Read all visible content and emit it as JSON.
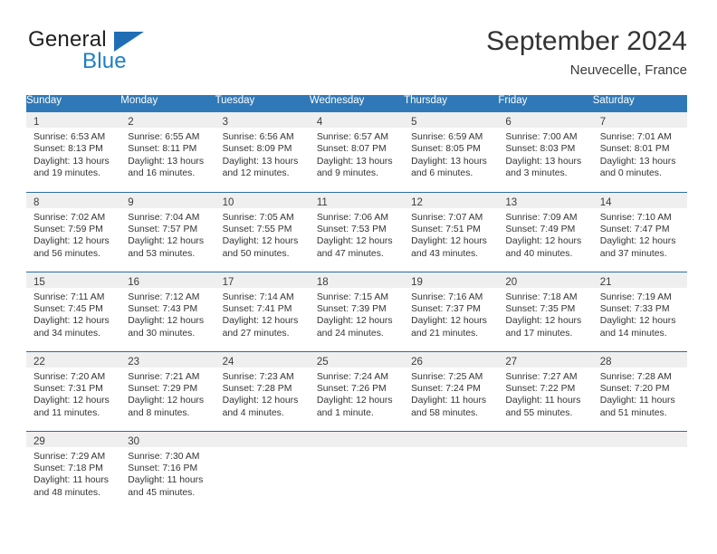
{
  "brand": {
    "word_general": "General",
    "word_blue": "Blue",
    "triangle_color": "#1f6eb5",
    "blue_text_color": "#1e7fc4"
  },
  "header": {
    "title": "September 2024",
    "location": "Neuvecelle, France"
  },
  "theme": {
    "header_row_bg": "#3079b8",
    "week_separator": "#2d6ca8",
    "daynum_band_bg": "#efefef"
  },
  "weekdays": [
    "Sunday",
    "Monday",
    "Tuesday",
    "Wednesday",
    "Thursday",
    "Friday",
    "Saturday"
  ],
  "weeks": [
    [
      {
        "day": "1",
        "sunrise": "Sunrise: 6:53 AM",
        "sunset": "Sunset: 8:13 PM",
        "daylight_1": "Daylight: 13 hours",
        "daylight_2": "and 19 minutes."
      },
      {
        "day": "2",
        "sunrise": "Sunrise: 6:55 AM",
        "sunset": "Sunset: 8:11 PM",
        "daylight_1": "Daylight: 13 hours",
        "daylight_2": "and 16 minutes."
      },
      {
        "day": "3",
        "sunrise": "Sunrise: 6:56 AM",
        "sunset": "Sunset: 8:09 PM",
        "daylight_1": "Daylight: 13 hours",
        "daylight_2": "and 12 minutes."
      },
      {
        "day": "4",
        "sunrise": "Sunrise: 6:57 AM",
        "sunset": "Sunset: 8:07 PM",
        "daylight_1": "Daylight: 13 hours",
        "daylight_2": "and 9 minutes."
      },
      {
        "day": "5",
        "sunrise": "Sunrise: 6:59 AM",
        "sunset": "Sunset: 8:05 PM",
        "daylight_1": "Daylight: 13 hours",
        "daylight_2": "and 6 minutes."
      },
      {
        "day": "6",
        "sunrise": "Sunrise: 7:00 AM",
        "sunset": "Sunset: 8:03 PM",
        "daylight_1": "Daylight: 13 hours",
        "daylight_2": "and 3 minutes."
      },
      {
        "day": "7",
        "sunrise": "Sunrise: 7:01 AM",
        "sunset": "Sunset: 8:01 PM",
        "daylight_1": "Daylight: 13 hours",
        "daylight_2": "and 0 minutes."
      }
    ],
    [
      {
        "day": "8",
        "sunrise": "Sunrise: 7:02 AM",
        "sunset": "Sunset: 7:59 PM",
        "daylight_1": "Daylight: 12 hours",
        "daylight_2": "and 56 minutes."
      },
      {
        "day": "9",
        "sunrise": "Sunrise: 7:04 AM",
        "sunset": "Sunset: 7:57 PM",
        "daylight_1": "Daylight: 12 hours",
        "daylight_2": "and 53 minutes."
      },
      {
        "day": "10",
        "sunrise": "Sunrise: 7:05 AM",
        "sunset": "Sunset: 7:55 PM",
        "daylight_1": "Daylight: 12 hours",
        "daylight_2": "and 50 minutes."
      },
      {
        "day": "11",
        "sunrise": "Sunrise: 7:06 AM",
        "sunset": "Sunset: 7:53 PM",
        "daylight_1": "Daylight: 12 hours",
        "daylight_2": "and 47 minutes."
      },
      {
        "day": "12",
        "sunrise": "Sunrise: 7:07 AM",
        "sunset": "Sunset: 7:51 PM",
        "daylight_1": "Daylight: 12 hours",
        "daylight_2": "and 43 minutes."
      },
      {
        "day": "13",
        "sunrise": "Sunrise: 7:09 AM",
        "sunset": "Sunset: 7:49 PM",
        "daylight_1": "Daylight: 12 hours",
        "daylight_2": "and 40 minutes."
      },
      {
        "day": "14",
        "sunrise": "Sunrise: 7:10 AM",
        "sunset": "Sunset: 7:47 PM",
        "daylight_1": "Daylight: 12 hours",
        "daylight_2": "and 37 minutes."
      }
    ],
    [
      {
        "day": "15",
        "sunrise": "Sunrise: 7:11 AM",
        "sunset": "Sunset: 7:45 PM",
        "daylight_1": "Daylight: 12 hours",
        "daylight_2": "and 34 minutes."
      },
      {
        "day": "16",
        "sunrise": "Sunrise: 7:12 AM",
        "sunset": "Sunset: 7:43 PM",
        "daylight_1": "Daylight: 12 hours",
        "daylight_2": "and 30 minutes."
      },
      {
        "day": "17",
        "sunrise": "Sunrise: 7:14 AM",
        "sunset": "Sunset: 7:41 PM",
        "daylight_1": "Daylight: 12 hours",
        "daylight_2": "and 27 minutes."
      },
      {
        "day": "18",
        "sunrise": "Sunrise: 7:15 AM",
        "sunset": "Sunset: 7:39 PM",
        "daylight_1": "Daylight: 12 hours",
        "daylight_2": "and 24 minutes."
      },
      {
        "day": "19",
        "sunrise": "Sunrise: 7:16 AM",
        "sunset": "Sunset: 7:37 PM",
        "daylight_1": "Daylight: 12 hours",
        "daylight_2": "and 21 minutes."
      },
      {
        "day": "20",
        "sunrise": "Sunrise: 7:18 AM",
        "sunset": "Sunset: 7:35 PM",
        "daylight_1": "Daylight: 12 hours",
        "daylight_2": "and 17 minutes."
      },
      {
        "day": "21",
        "sunrise": "Sunrise: 7:19 AM",
        "sunset": "Sunset: 7:33 PM",
        "daylight_1": "Daylight: 12 hours",
        "daylight_2": "and 14 minutes."
      }
    ],
    [
      {
        "day": "22",
        "sunrise": "Sunrise: 7:20 AM",
        "sunset": "Sunset: 7:31 PM",
        "daylight_1": "Daylight: 12 hours",
        "daylight_2": "and 11 minutes."
      },
      {
        "day": "23",
        "sunrise": "Sunrise: 7:21 AM",
        "sunset": "Sunset: 7:29 PM",
        "daylight_1": "Daylight: 12 hours",
        "daylight_2": "and 8 minutes."
      },
      {
        "day": "24",
        "sunrise": "Sunrise: 7:23 AM",
        "sunset": "Sunset: 7:28 PM",
        "daylight_1": "Daylight: 12 hours",
        "daylight_2": "and 4 minutes."
      },
      {
        "day": "25",
        "sunrise": "Sunrise: 7:24 AM",
        "sunset": "Sunset: 7:26 PM",
        "daylight_1": "Daylight: 12 hours",
        "daylight_2": "and 1 minute."
      },
      {
        "day": "26",
        "sunrise": "Sunrise: 7:25 AM",
        "sunset": "Sunset: 7:24 PM",
        "daylight_1": "Daylight: 11 hours",
        "daylight_2": "and 58 minutes."
      },
      {
        "day": "27",
        "sunrise": "Sunrise: 7:27 AM",
        "sunset": "Sunset: 7:22 PM",
        "daylight_1": "Daylight: 11 hours",
        "daylight_2": "and 55 minutes."
      },
      {
        "day": "28",
        "sunrise": "Sunrise: 7:28 AM",
        "sunset": "Sunset: 7:20 PM",
        "daylight_1": "Daylight: 11 hours",
        "daylight_2": "and 51 minutes."
      }
    ],
    [
      {
        "day": "29",
        "sunrise": "Sunrise: 7:29 AM",
        "sunset": "Sunset: 7:18 PM",
        "daylight_1": "Daylight: 11 hours",
        "daylight_2": "and 48 minutes."
      },
      {
        "day": "30",
        "sunrise": "Sunrise: 7:30 AM",
        "sunset": "Sunset: 7:16 PM",
        "daylight_1": "Daylight: 11 hours",
        "daylight_2": "and 45 minutes."
      },
      {
        "day": "",
        "sunrise": "",
        "sunset": "",
        "daylight_1": "",
        "daylight_2": ""
      },
      {
        "day": "",
        "sunrise": "",
        "sunset": "",
        "daylight_1": "",
        "daylight_2": ""
      },
      {
        "day": "",
        "sunrise": "",
        "sunset": "",
        "daylight_1": "",
        "daylight_2": ""
      },
      {
        "day": "",
        "sunrise": "",
        "sunset": "",
        "daylight_1": "",
        "daylight_2": ""
      },
      {
        "day": "",
        "sunrise": "",
        "sunset": "",
        "daylight_1": "",
        "daylight_2": ""
      }
    ]
  ]
}
